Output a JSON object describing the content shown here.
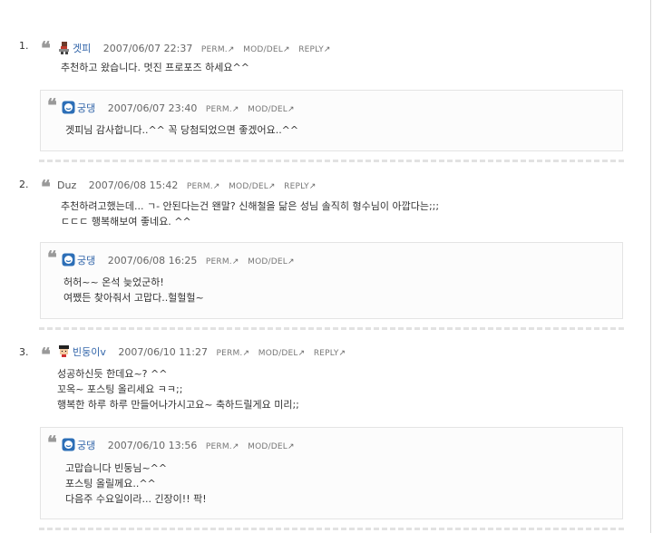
{
  "comments": [
    {
      "number": "1.",
      "author": "겟피",
      "avatar_icon": "character-avatar-icon",
      "date": "2007/06/07 22:37",
      "actions": [
        "PERM.",
        "MOD/DEL",
        "REPLY"
      ],
      "lines": [
        "추천하고 왔습니다. 멋진 프로포즈 하세요^^"
      ],
      "reply": {
        "author": "궁댕",
        "date": "2007/06/07 23:40",
        "actions": [
          "PERM.",
          "MOD/DEL"
        ],
        "lines": [
          "겟피님 감사합니다..^^ 꼭 당첨되었으면 좋겠어요..^^"
        ]
      }
    },
    {
      "number": "2.",
      "author": "Duz",
      "date": "2007/06/08 15:42",
      "actions": [
        "PERM.",
        "MOD/DEL",
        "REPLY"
      ],
      "lines": [
        "추천하려고했는데... ㄱ- 안된다는건 왠말? 신해철을 닮은 성님 솔직히 형수님이 아깝다는;;;",
        "ㄷㄷㄷ 행복해보여 좋네요. ^^"
      ],
      "reply": {
        "author": "궁댕",
        "date": "2007/06/08 16:25",
        "actions": [
          "PERM.",
          "MOD/DEL"
        ],
        "lines": [
          "허허~~ 온석 늦었군하!",
          "여쨌든 찾아줘서 고맙다..헐헐헐~"
        ]
      }
    },
    {
      "number": "3.",
      "author": "빈둥이v",
      "avatar_icon": "pixel-face-avatar-icon",
      "date": "2007/06/10 11:27",
      "actions": [
        "PERM.",
        "MOD/DEL",
        "REPLY"
      ],
      "lines": [
        "성공하신듯 한데요~? ^^",
        "꼬옥~ 포스팅 올리세요 ㅋㅋ;;",
        "행복한 하루 하루 만들어나가시고요~ 축하드릴게요 미리;;"
      ],
      "reply": {
        "author": "궁댕",
        "date": "2007/06/10 13:56",
        "actions": [
          "PERM.",
          "MOD/DEL"
        ],
        "lines": [
          "고맙습니다 빈둥님~^^",
          "포스팅 올릴께요..^^",
          "다음주 수요일이라... 긴장이!! 팍!"
        ]
      }
    }
  ],
  "colors": {
    "author_link": "#3366aa",
    "separator": "#e2e2e2",
    "reply_border": "#e4e4e4"
  },
  "icons": {
    "quote": "quote-mark-icon",
    "reply_author_avatar": "smiley-badge-icon",
    "action_arrow": "arrow-ne-icon"
  }
}
